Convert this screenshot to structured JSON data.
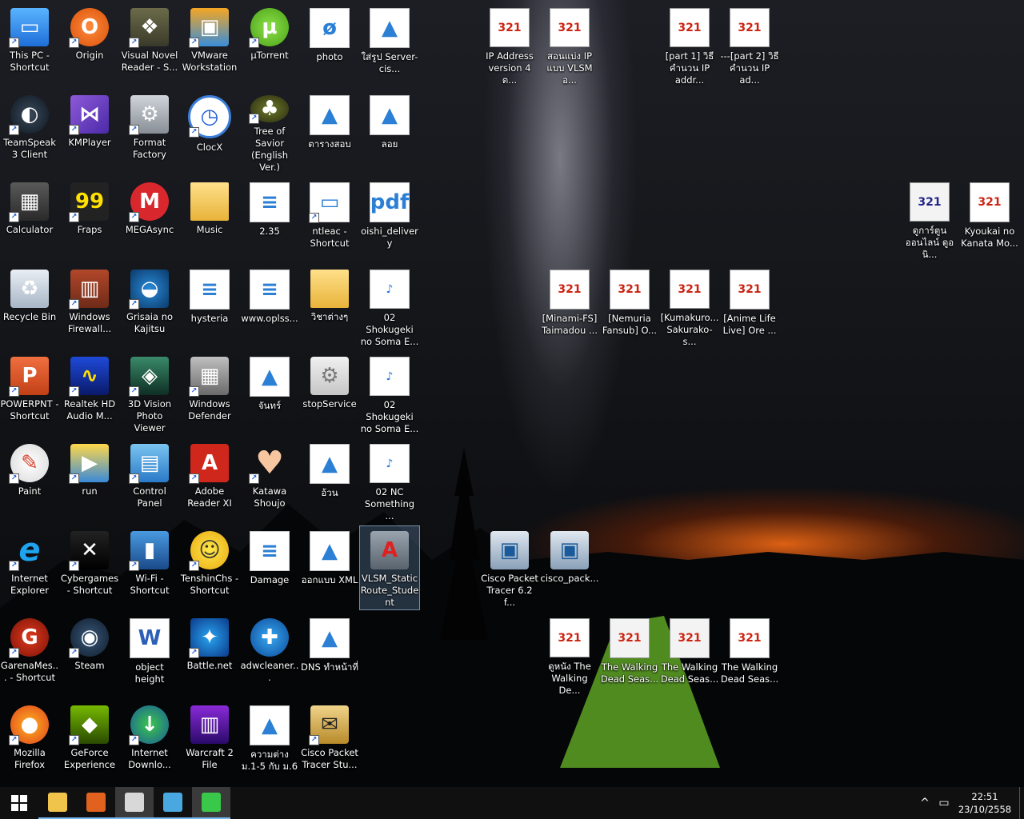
{
  "desktop_icons": [
    {
      "label": "This PC - Shortcut",
      "icon": "computer-icon",
      "glyph": "▭",
      "style": "t-pc",
      "shortcut": true
    },
    {
      "label": "TeamSpeak 3 Client",
      "icon": "teamspeak-icon",
      "glyph": "◐",
      "style": "t-ts3",
      "shortcut": true
    },
    {
      "label": "Calculator",
      "icon": "calculator-icon",
      "glyph": "▦",
      "style": "t-calc",
      "shortcut": true
    },
    {
      "label": "Recycle Bin",
      "icon": "recycle-bin-icon",
      "glyph": "♻",
      "style": "t-recycle",
      "shortcut": false
    },
    {
      "label": "POWERPNT - Shortcut",
      "icon": "powerpoint-icon",
      "glyph": "P",
      "style": "t-ppt",
      "shortcut": true
    },
    {
      "label": "Paint",
      "icon": "paint-icon",
      "glyph": "✎",
      "style": "t-paint",
      "shortcut": true
    },
    {
      "label": "Internet Explorer",
      "icon": "internet-explorer-icon",
      "glyph": "e",
      "style": "t-ie",
      "shortcut": true
    },
    {
      "label": "GarenaMes... - Shortcut",
      "icon": "garena-icon",
      "glyph": "G",
      "style": "t-garena",
      "shortcut": true
    },
    {
      "label": "Mozilla Firefox",
      "icon": "firefox-icon",
      "glyph": "●",
      "style": "t-firefox",
      "shortcut": true
    },
    {
      "label": "Origin",
      "icon": "origin-icon",
      "glyph": "O",
      "style": "t-orange",
      "shortcut": true
    },
    {
      "label": "KMPlayer",
      "icon": "kmplayer-icon",
      "glyph": "⋈",
      "style": "t-kmp",
      "shortcut": true
    },
    {
      "label": "Fraps",
      "icon": "fraps-icon",
      "glyph": "99",
      "style": "t-fraps",
      "shortcut": true
    },
    {
      "label": "Windows Firewall...",
      "icon": "firewall-icon",
      "glyph": "▥",
      "style": "t-firewall",
      "shortcut": true
    },
    {
      "label": "Realtek HD Audio M...",
      "icon": "realtek-icon",
      "glyph": "∿",
      "style": "t-realtek",
      "shortcut": true
    },
    {
      "label": "run",
      "icon": "run-icon",
      "glyph": "▶",
      "style": "t-run",
      "shortcut": true
    },
    {
      "label": "Cybergames - Shortcut",
      "icon": "cybergames-icon",
      "glyph": "✕",
      "style": "t-cyber",
      "shortcut": true
    },
    {
      "label": "Steam",
      "icon": "steam-icon",
      "glyph": "◉",
      "style": "t-steam",
      "shortcut": true
    },
    {
      "label": "GeForce Experience",
      "icon": "geforce-icon",
      "glyph": "◆",
      "style": "t-nvidia",
      "shortcut": true
    },
    {
      "label": "Visual Novel Reader - S...",
      "icon": "visual-novel-reader-icon",
      "glyph": "❖",
      "style": "t-book",
      "shortcut": true
    },
    {
      "label": "Format Factory",
      "icon": "format-factory-icon",
      "glyph": "⚙",
      "style": "t-ff",
      "shortcut": true
    },
    {
      "label": "MEGAsync",
      "icon": "megasync-icon",
      "glyph": "M",
      "style": "t-mega",
      "shortcut": true
    },
    {
      "label": "Grisaia no Kajitsu",
      "icon": "grisaia-icon",
      "glyph": "◒",
      "style": "t-grisaia",
      "shortcut": true
    },
    {
      "label": "3D Vision Photo Viewer",
      "icon": "3d-vision-icon",
      "glyph": "◈",
      "style": "t-3dv",
      "shortcut": true
    },
    {
      "label": "Control Panel",
      "icon": "control-panel-icon",
      "glyph": "▤",
      "style": "t-cp",
      "shortcut": true
    },
    {
      "label": "Wi-Fi - Shortcut",
      "icon": "wifi-icon",
      "glyph": "▮",
      "style": "t-wifi",
      "shortcut": true
    },
    {
      "label": "object height",
      "icon": "word-document-icon",
      "glyph": "W",
      "style": "t-word",
      "shortcut": false
    },
    {
      "label": "Internet Downlo...",
      "icon": "internet-download-manager-icon",
      "glyph": "↓",
      "style": "t-idm",
      "shortcut": true
    },
    {
      "label": "VMware Workstation",
      "icon": "vmware-icon",
      "glyph": "▣",
      "style": "t-vm",
      "shortcut": true
    },
    {
      "label": "ClocX",
      "icon": "clock-icon",
      "glyph": "◷",
      "style": "t-clock",
      "shortcut": true
    },
    {
      "label": "Music",
      "icon": "folder-icon",
      "glyph": "",
      "style": "t-folder",
      "shortcut": false
    },
    {
      "label": "hysteria",
      "icon": "text-file-icon",
      "glyph": "≡",
      "style": "t-doc",
      "shortcut": false
    },
    {
      "label": "Windows Defender",
      "icon": "windows-defender-icon",
      "glyph": "▦",
      "style": "t-wall",
      "shortcut": true
    },
    {
      "label": "Adobe Reader XI",
      "icon": "adobe-reader-icon",
      "glyph": "A",
      "style": "t-adobe",
      "shortcut": true
    },
    {
      "label": "TenshinChs - Shortcut",
      "icon": "tenshin-icon",
      "glyph": "☺",
      "style": "t-tenshin",
      "shortcut": true
    },
    {
      "label": "Battle.net",
      "icon": "battlenet-icon",
      "glyph": "✦",
      "style": "t-bnet",
      "shortcut": true
    },
    {
      "label": "Warcraft 2 File",
      "icon": "winrar-icon",
      "glyph": "▥",
      "style": "t-rar",
      "shortcut": false
    },
    {
      "label": "µTorrent",
      "icon": "utorrent-icon",
      "glyph": "µ",
      "style": "t-green",
      "shortcut": true
    },
    {
      "label": "Tree of Savior (English Ver.)",
      "icon": "tree-of-savior-icon",
      "glyph": "♣",
      "style": "t-tos",
      "shortcut": true
    },
    {
      "label": "2.35",
      "icon": "text-file-icon",
      "glyph": "≡",
      "style": "t-doc",
      "shortcut": false
    },
    {
      "label": "www.oplss...",
      "icon": "text-file-icon",
      "glyph": "≡",
      "style": "t-doc",
      "shortcut": false
    },
    {
      "label": "จันทร์",
      "icon": "image-file-icon",
      "glyph": "▲",
      "style": "t-img",
      "shortcut": false
    },
    {
      "label": "Katawa Shoujo",
      "icon": "heart-icon",
      "glyph": "♥",
      "style": "t-heart",
      "shortcut": true
    },
    {
      "label": "Damage",
      "icon": "text-file-icon",
      "glyph": "≡",
      "style": "t-doc",
      "shortcut": false
    },
    {
      "label": "adwcleaner...",
      "icon": "adwcleaner-icon",
      "glyph": "✚",
      "style": "t-adw",
      "shortcut": false
    },
    {
      "label": "ความต่าง ม.1-5 กับ ม.6",
      "icon": "image-file-icon",
      "glyph": "▲",
      "style": "t-img",
      "shortcut": false
    },
    {
      "label": "photo",
      "icon": "dreamweaver-icon",
      "glyph": "ø",
      "style": "t-doc",
      "shortcut": false
    },
    {
      "label": "ตารางสอบ",
      "icon": "image-file-icon",
      "glyph": "▲",
      "style": "t-img",
      "shortcut": false
    },
    {
      "label": "ntleac - Shortcut",
      "icon": "window-icon",
      "glyph": "▭",
      "style": "t-doc",
      "shortcut": true
    },
    {
      "label": "วิชาต่างๆ",
      "icon": "folder-icon",
      "glyph": "",
      "style": "t-folder",
      "shortcut": false
    },
    {
      "label": "stopService",
      "icon": "settings-file-icon",
      "glyph": "⚙",
      "style": "t-gear",
      "shortcut": false
    },
    {
      "label": "อ้วน",
      "icon": "image-file-icon",
      "glyph": "▲",
      "style": "t-img",
      "shortcut": false
    },
    {
      "label": "ออกแบบ XML",
      "icon": "image-file-icon",
      "glyph": "▲",
      "style": "t-img",
      "shortcut": false
    },
    {
      "label": "DNS ทำหน้าที่",
      "icon": "image-file-icon",
      "glyph": "▲",
      "style": "t-img",
      "shortcut": false
    },
    {
      "label": "Cisco Packet Tracer Stu...",
      "icon": "cisco-packet-tracer-icon",
      "glyph": "✉",
      "style": "t-cpts",
      "shortcut": true
    },
    {
      "label": "ใส่รูป Server-cis...",
      "icon": "image-file-icon",
      "glyph": "▲",
      "style": "t-img",
      "shortcut": false
    },
    {
      "label": "ลอย",
      "icon": "image-file-icon",
      "glyph": "▲",
      "style": "t-img",
      "shortcut": false
    },
    {
      "label": "oishi_delivery",
      "icon": "pdf-icon",
      "glyph": "pdf",
      "style": "t-doc",
      "shortcut": false
    },
    {
      "label": "02 Shokugeki no Soma E...",
      "icon": "mp3-icon",
      "glyph": "♪",
      "style": "t-mp3",
      "shortcut": false
    },
    {
      "label": "02 Shokugeki no Soma E...",
      "icon": "mp3-icon",
      "glyph": "♪",
      "style": "t-mp3",
      "shortcut": false
    },
    {
      "label": "02 NC Something ...",
      "icon": "mp3-icon",
      "glyph": "♪",
      "style": "t-mp3",
      "shortcut": false
    },
    {
      "label": "VLSM_StaticRoute_Student",
      "icon": "vlsm-activity-icon",
      "glyph": "A",
      "style": "t-vlsm",
      "shortcut": false,
      "selected": true
    },
    {
      "label": "IP Address version 4 ต...",
      "icon": "mp4-video-icon",
      "glyph": "321",
      "style": "t-mp4",
      "shortcut": false
    },
    {
      "label": "สอนแบ่ง IP แบบ VLSM อ...",
      "icon": "mp4-video-icon",
      "glyph": "321",
      "style": "t-mp4",
      "shortcut": false
    },
    {
      "label": "[part 1] วิธีคำนวน IP addr...",
      "icon": "mp4-video-icon",
      "glyph": "321",
      "style": "t-mp4",
      "shortcut": false
    },
    {
      "label": "---[part 2] วิธีคำนวน IP ad...",
      "icon": "mp4-video-icon",
      "glyph": "321",
      "style": "t-mp4",
      "shortcut": false
    },
    {
      "label": "[Minami-FS] Taimadou ...",
      "icon": "mp4-video-icon",
      "glyph": "321",
      "style": "t-mp4",
      "shortcut": false
    },
    {
      "label": "[Nemuria Fansub] O...",
      "icon": "mp4-video-icon",
      "glyph": "321",
      "style": "t-mp4",
      "shortcut": false
    },
    {
      "label": "[Kumakuro... Sakurako-s...",
      "icon": "mp4-video-icon",
      "glyph": "321",
      "style": "t-mp4",
      "shortcut": false
    },
    {
      "label": "[Anime Life Live] Ore ...",
      "icon": "mkv-video-icon",
      "glyph": "321",
      "style": "t-mp4",
      "shortcut": false
    },
    {
      "label": "Cisco Packet Tracer 6.2 f...",
      "icon": "installer-icon",
      "glyph": "▣",
      "style": "t-cisco",
      "shortcut": false
    },
    {
      "label": "cisco_pack...",
      "icon": "installer-icon",
      "glyph": "▣",
      "style": "t-cisco",
      "shortcut": false
    },
    {
      "label": "ดูหนัง The Walking De...",
      "icon": "mp4-video-icon",
      "glyph": "321",
      "style": "t-mp4",
      "shortcut": false
    },
    {
      "label": "The Walking Dead Seas...",
      "icon": "ts-video-icon",
      "glyph": "321",
      "style": "t-ts",
      "shortcut": false
    },
    {
      "label": "The Walking Dead Seas...",
      "icon": "ts-video-icon",
      "glyph": "321",
      "style": "t-ts",
      "shortcut": false
    },
    {
      "label": "The Walking Dead Seas...",
      "icon": "mp4-video-icon",
      "glyph": "321",
      "style": "t-mp4",
      "shortcut": false
    },
    {
      "label": "ดูการ์ตูนออนไลน์ ดูอนิ...",
      "icon": "ts-video-icon",
      "glyph": "321",
      "style": "t-ts2",
      "shortcut": false
    },
    {
      "label": "Kyoukai no Kanata Mo...",
      "icon": "mp4-video-icon",
      "glyph": "321",
      "style": "t-mp4",
      "shortcut": false
    }
  ],
  "taskbar": {
    "start": {
      "icon": "windows-logo-icon"
    },
    "apps": [
      {
        "name": "file-explorer",
        "icon": "folder-icon",
        "color": "#f0c44a",
        "state": "open"
      },
      {
        "name": "firefox",
        "icon": "firefox-icon",
        "color": "#e0621e",
        "state": "open"
      },
      {
        "name": "media-player-classic",
        "icon": "clapperboard-icon",
        "color": "#d8d8d8",
        "state": "active"
      },
      {
        "name": "media-player",
        "icon": "play-icon",
        "color": "#4aa8e0",
        "state": "open"
      },
      {
        "name": "internet-download-manager",
        "icon": "download-globe-icon",
        "color": "#3ac84a",
        "state": "active"
      }
    ]
  },
  "tray": {
    "chevron": "^",
    "notifications": "▭",
    "time": "22:51",
    "date": "23/10/2558"
  }
}
